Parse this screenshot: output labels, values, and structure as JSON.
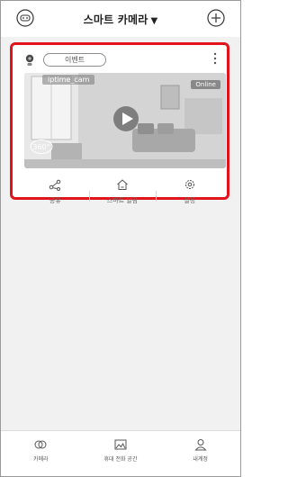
{
  "header": {
    "title": "스마트 카메라",
    "caret": "▼",
    "left_icon": "ai-face-icon",
    "right_icon": "add-circle-icon"
  },
  "camera_card": {
    "event_label": "이벤트",
    "camera_name": "iptime_cam",
    "status": "Online",
    "badge_360": "360°",
    "highlight_color": "#e0141a",
    "actions": [
      {
        "label": "공유",
        "icon": "share-icon"
      },
      {
        "label": "스마트 알람",
        "icon": "home-alarm-icon"
      },
      {
        "label": "설정",
        "icon": "gear-icon"
      }
    ]
  },
  "bottom_nav": [
    {
      "label": "카메라",
      "icon": "camera-nav-icon"
    },
    {
      "label": "휴대 전화 공간",
      "icon": "gallery-icon"
    },
    {
      "label": "내계정",
      "icon": "account-icon"
    }
  ]
}
